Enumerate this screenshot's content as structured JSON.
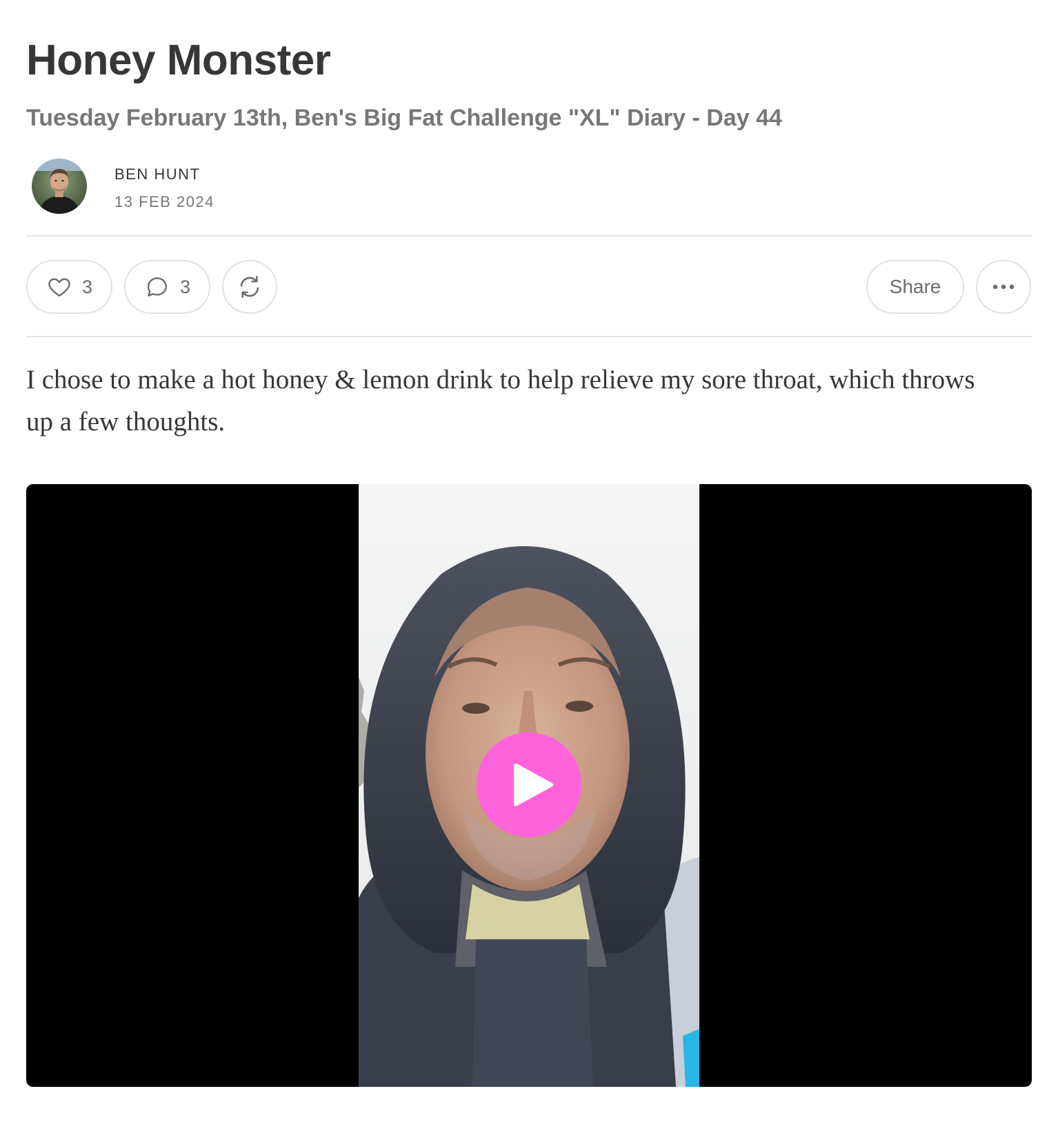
{
  "post": {
    "title": "Honey Monster",
    "subtitle": "Tuesday February 13th, Ben's Big Fat Challenge \"XL\" Diary - Day 44",
    "author": "BEN HUNT",
    "date": "13 FEB 2024",
    "body": "I chose to make a hot honey & lemon drink to help relieve my sore throat, which throws up a few thoughts."
  },
  "actions": {
    "like": {
      "icon": "heart-icon",
      "count": "3"
    },
    "comment": {
      "icon": "comment-icon",
      "count": "3"
    },
    "restack": {
      "icon": "restack-icon"
    },
    "share_label": "Share",
    "more": {
      "icon": "more-horizontal-icon"
    }
  },
  "video": {
    "play_icon": "play-icon"
  },
  "colors": {
    "accent": "#ff63dc",
    "text": "#363737",
    "muted": "#777777",
    "divider": "#e3e3e3"
  }
}
